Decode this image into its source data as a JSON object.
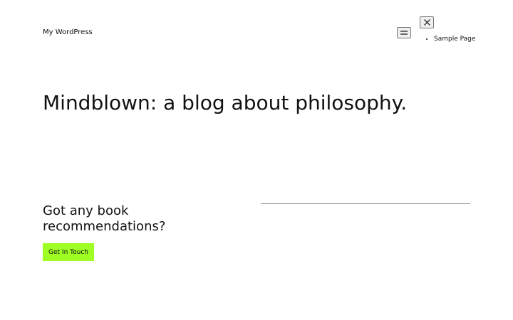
{
  "header": {
    "site_title": "My WordPress",
    "menu_open_icon": "hamburger-icon",
    "menu_close_icon": "close-icon",
    "nav_items": [
      {
        "label": "Sample Page"
      }
    ]
  },
  "main": {
    "title": "Mindblown: a blog about philosophy."
  },
  "footer_cta": {
    "heading": "Got any book recommendations?",
    "button_label": "Get In Touch"
  },
  "colors": {
    "text": "#111111",
    "button_background": "#9efe23",
    "separator": "#8e8e8e"
  }
}
